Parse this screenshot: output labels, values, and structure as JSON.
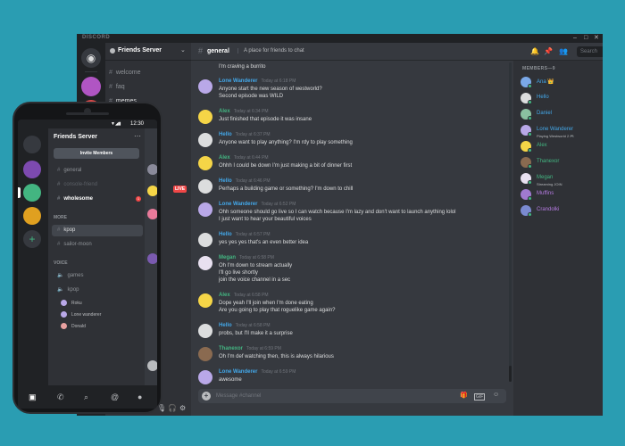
{
  "desktop": {
    "app_name": "DISCORD",
    "window_controls": [
      "–",
      "□",
      "✕"
    ],
    "server_name": "Friends Server",
    "channels": [
      {
        "name": "welcome",
        "active": false
      },
      {
        "name": "faq",
        "active": false
      },
      {
        "name": "memes",
        "active": true
      }
    ],
    "header": {
      "channel": "general",
      "topic": "A place for friends to chat",
      "search_placeholder": "Search"
    },
    "messages": [
      {
        "author": "",
        "time": "",
        "color": "#dcddde",
        "avatar": "#b9a8e8",
        "lines": [
          "I'm craving a burrito"
        ]
      },
      {
        "author": "Lone Wanderer",
        "time": "Today at 6:18 PM",
        "color": "#43a7e8",
        "avatar": "#b9a8e8",
        "lines": [
          "Anyone start the new season of westworld?",
          "Second episode was WILD"
        ]
      },
      {
        "author": "Alex",
        "time": "Today at 6:34 PM",
        "color": "#43b581",
        "avatar": "#f5d547",
        "lines": [
          "Just finished that episode it was insane"
        ]
      },
      {
        "author": "Hello",
        "time": "Today at 6:37 PM",
        "color": "#43a7e8",
        "avatar": "#dcddde",
        "lines": [
          "Anyone want to play anything? I'm rdy to play something"
        ]
      },
      {
        "author": "Alex",
        "time": "Today at 6:44 PM",
        "color": "#43b581",
        "avatar": "#f5d547",
        "lines": [
          "Ohhh I could be down I'm just making a bit of dinner first"
        ]
      },
      {
        "author": "Hello",
        "time": "Today at 6:46 PM",
        "color": "#43a7e8",
        "avatar": "#dcddde",
        "lines": [
          "Perhaps a building game or something? I'm down to chill"
        ]
      },
      {
        "author": "Lone Wanderer",
        "time": "Today at 6:52 PM",
        "color": "#43a7e8",
        "avatar": "#b9a8e8",
        "lines": [
          "Ohh someone should go live so I can watch because I'm lazy and don't want to launch anything lolol",
          "I just want to hear your beautiful voices"
        ]
      },
      {
        "author": "Hello",
        "time": "Today at 6:57 PM",
        "color": "#43a7e8",
        "avatar": "#dcddde",
        "lines": [
          "yes yes yes that's an even better idea"
        ]
      },
      {
        "author": "Megan",
        "time": "Today at 6:58 PM",
        "color": "#43b581",
        "avatar": "#e8e0f0",
        "lines": [
          "Oh I'm down to stream actually",
          "I'll go live shortly",
          "join the voice channel in a sec"
        ]
      },
      {
        "author": "Alex",
        "time": "Today at 6:58 PM",
        "color": "#43b581",
        "avatar": "#f5d547",
        "lines": [
          "Dope yeah I'll join when I'm done eating",
          "Are you going to play that roguelike game again?"
        ]
      },
      {
        "author": "Hello",
        "time": "Today at 6:58 PM",
        "color": "#43a7e8",
        "avatar": "#dcddde",
        "lines": [
          "probs, but I'll make it a surprise"
        ]
      },
      {
        "author": "Thanexor",
        "time": "Today at 6:59 PM",
        "color": "#43b581",
        "avatar": "#8a6a50",
        "lines": [
          "Oh I'm def watching then, this is always hilarious"
        ]
      },
      {
        "author": "Lone Wanderer",
        "time": "Today at 6:59 PM",
        "color": "#43a7e8",
        "avatar": "#b9a8e8",
        "lines": [
          "awesome"
        ]
      }
    ],
    "composer_placeholder": "Message #channel",
    "members_header": "MEMBERS—9",
    "members": [
      {
        "name": "Ana",
        "extra": "👑",
        "activity": "",
        "color": "#43a7e8",
        "avatar": "#7aa8e8"
      },
      {
        "name": "Hello",
        "extra": "",
        "activity": "",
        "color": "#43a7e8",
        "avatar": "#dcddde"
      },
      {
        "name": "Daniel",
        "extra": "",
        "activity": "",
        "color": "#43a7e8",
        "avatar": "#8ac0a0"
      },
      {
        "name": "Lone Wanderer",
        "extra": "",
        "activity": "Playing Westworld 2 🎮",
        "color": "#43a7e8",
        "avatar": "#b9a8e8"
      },
      {
        "name": "Alex",
        "extra": "",
        "activity": "",
        "color": "#43b581",
        "avatar": "#f5d547"
      },
      {
        "name": "Thanexor",
        "extra": "",
        "activity": "",
        "color": "#43b581",
        "avatar": "#8a6a50"
      },
      {
        "name": "Megan",
        "extra": "",
        "activity": "Streaming JOIN",
        "color": "#43b581",
        "avatar": "#e8e0f0"
      },
      {
        "name": "Muffins",
        "extra": "",
        "activity": "",
        "color": "#b47ae0",
        "avatar": "#a07ad0"
      },
      {
        "name": "Crandolki",
        "extra": "",
        "activity": "",
        "color": "#b47ae0",
        "avatar": "#7a8ad0"
      }
    ]
  },
  "phone": {
    "time": "12:30",
    "server_name": "Friends Server",
    "invite_label": "Invite Members",
    "text_channels": [
      {
        "name": "general",
        "style": "normal"
      },
      {
        "name": "console-friend",
        "style": "dim"
      },
      {
        "name": "wholesome",
        "style": "bold"
      }
    ],
    "badge": "1",
    "more_label": "MORE",
    "more_channels": [
      {
        "name": "kpop"
      },
      {
        "name": "sailor-moon"
      }
    ],
    "voice_label": "VOICE",
    "voice_channels": [
      {
        "name": "games"
      },
      {
        "name": "kpop"
      }
    ],
    "voice_users": [
      {
        "name": "Roku",
        "avatar": "#b9a8e8"
      },
      {
        "name": "Lone wanderer",
        "avatar": "#b9a8e8"
      },
      {
        "name": "Donald",
        "avatar": "#e8a0a0"
      }
    ],
    "live_label": "LIVE"
  }
}
